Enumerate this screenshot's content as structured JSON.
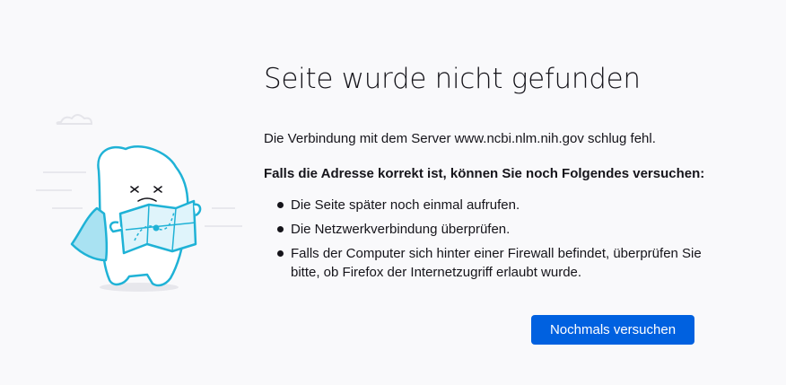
{
  "error_page": {
    "title": "Seite wurde nicht gefunden",
    "description": "Die Verbindung mit dem Server www.ncbi.nlm.nih.gov schlug fehl.",
    "suggestions_heading": "Falls die Adresse korrekt ist, können Sie noch Folgendes versuchen:",
    "suggestions": [
      "Die Seite später noch einmal aufrufen.",
      "Die Netzwerkverbindung überprüfen.",
      "Falls der Computer sich hinter einer Firewall befindet, überprüfen Sie bitte, ob Firefox der Internetzugriff erlaubt wurde."
    ],
    "retry_button_label": "Nochmals versuchen"
  },
  "illustration": {
    "icon": "lost-map-creature-illustration"
  },
  "colors": {
    "background": "#f9f9fb",
    "text": "#15141a",
    "button": "#0061e0",
    "illustration_stroke": "#1fb2d6"
  }
}
